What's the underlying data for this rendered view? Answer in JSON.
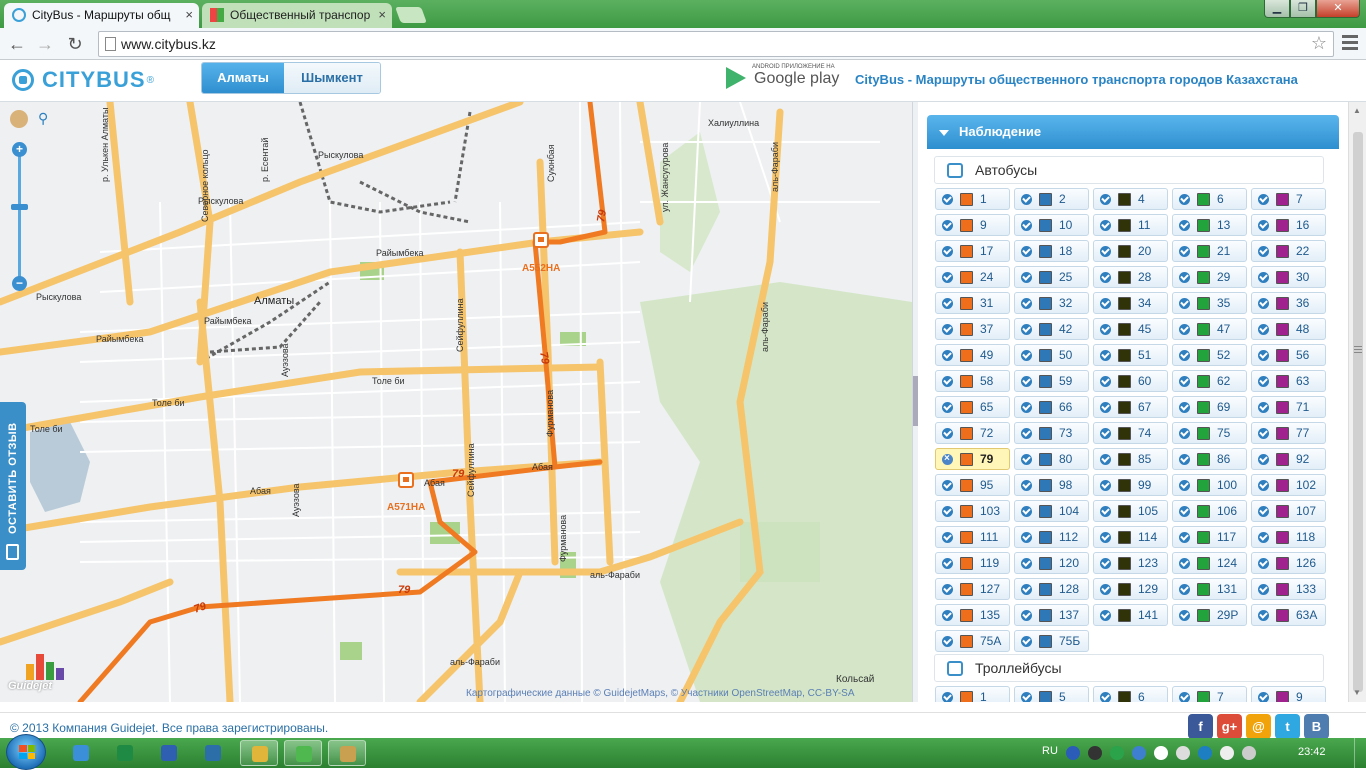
{
  "browser": {
    "tabs": [
      {
        "label": "CityBus - Маршруты общ",
        "active": true
      },
      {
        "label": "Общественный транспор",
        "active": false
      }
    ],
    "url": "www.citybus.kz"
  },
  "site": {
    "logo_text": "CITYBUS",
    "logo_reg": "®",
    "cities": [
      {
        "label": "Алматы",
        "active": true
      },
      {
        "label": "Шымкент",
        "active": false
      }
    ],
    "gplay_small": "ANDROID ПРИЛОЖЕНИЕ НА",
    "gplay_big": "Google play",
    "title": "CityBus - Маршруты общественного транспорта городов Казахстана"
  },
  "map": {
    "city_label": "Алматы",
    "district_label": "Кольсай",
    "attribution": "Картографические данные © GuidejetMaps, © Участники OpenStreetMap, CC-BY-SA",
    "guidejet_logo": "Guidejet",
    "feedback_label": "ОСТАВИТЬ ОТЗЫВ",
    "zoom_in": "+",
    "zoom_out": "−",
    "road_labels": [
      {
        "text": "Рыскулова"
      },
      {
        "text": "Рыскулова"
      },
      {
        "text": "Рыскулова"
      },
      {
        "text": "Райымбека"
      },
      {
        "text": "Райымбека"
      },
      {
        "text": "Райымбека"
      },
      {
        "text": "Толе би"
      },
      {
        "text": "Толе би"
      },
      {
        "text": "Толе би"
      },
      {
        "text": "Абая"
      },
      {
        "text": "Абая"
      },
      {
        "text": "Абая"
      },
      {
        "text": "аль-Фараби"
      },
      {
        "text": "аль-Фараби"
      },
      {
        "text": "Халиуллина"
      },
      {
        "text": "Суюнбая"
      },
      {
        "text": "Сейфуллина"
      },
      {
        "text": "Сейфуллина"
      },
      {
        "text": "Фурманова"
      },
      {
        "text": "Фурманова"
      },
      {
        "text": "Ауэзова"
      },
      {
        "text": "Ауэзова"
      },
      {
        "text": "Северное кольцо"
      },
      {
        "text": "р. Есентай"
      },
      {
        "text": "ул. Жансугурова"
      },
      {
        "text": "аль-Фараби"
      },
      {
        "text": "аль-Фараби"
      },
      {
        "text": "р. Улькен Алматы"
      }
    ],
    "route_labels": [
      "79",
      "79",
      "79",
      "79",
      "79"
    ],
    "buses": [
      {
        "label": "А552НА"
      },
      {
        "label": "А571НА"
      }
    ]
  },
  "panel": {
    "header": "Наблюдение",
    "colors": {
      "c1": "#ef6e1b",
      "c2": "#2f78b7",
      "c3": "#2f3307",
      "c4": "#23a33b",
      "c5": "#a0228f"
    },
    "groups": [
      {
        "title": "Автобусы",
        "routes": [
          {
            "n": "1",
            "c": "#ef6e1b"
          },
          {
            "n": "2",
            "c": "#2f78b7"
          },
          {
            "n": "4",
            "c": "#2f3307"
          },
          {
            "n": "6",
            "c": "#23a33b"
          },
          {
            "n": "7",
            "c": "#a0228f"
          },
          {
            "n": "9",
            "c": "#ef6e1b"
          },
          {
            "n": "10",
            "c": "#2f78b7"
          },
          {
            "n": "11",
            "c": "#2f3307"
          },
          {
            "n": "13",
            "c": "#23a33b"
          },
          {
            "n": "16",
            "c": "#a0228f"
          },
          {
            "n": "17",
            "c": "#ef6e1b"
          },
          {
            "n": "18",
            "c": "#2f78b7"
          },
          {
            "n": "20",
            "c": "#2f3307"
          },
          {
            "n": "21",
            "c": "#23a33b"
          },
          {
            "n": "22",
            "c": "#a0228f"
          },
          {
            "n": "24",
            "c": "#ef6e1b"
          },
          {
            "n": "25",
            "c": "#2f78b7"
          },
          {
            "n": "28",
            "c": "#2f3307"
          },
          {
            "n": "29",
            "c": "#23a33b"
          },
          {
            "n": "30",
            "c": "#a0228f"
          },
          {
            "n": "31",
            "c": "#ef6e1b"
          },
          {
            "n": "32",
            "c": "#2f78b7"
          },
          {
            "n": "34",
            "c": "#2f3307"
          },
          {
            "n": "35",
            "c": "#23a33b"
          },
          {
            "n": "36",
            "c": "#a0228f"
          },
          {
            "n": "37",
            "c": "#ef6e1b"
          },
          {
            "n": "42",
            "c": "#2f78b7"
          },
          {
            "n": "45",
            "c": "#2f3307"
          },
          {
            "n": "47",
            "c": "#23a33b"
          },
          {
            "n": "48",
            "c": "#a0228f"
          },
          {
            "n": "49",
            "c": "#ef6e1b"
          },
          {
            "n": "50",
            "c": "#2f78b7"
          },
          {
            "n": "51",
            "c": "#2f3307"
          },
          {
            "n": "52",
            "c": "#23a33b"
          },
          {
            "n": "56",
            "c": "#a0228f"
          },
          {
            "n": "58",
            "c": "#ef6e1b"
          },
          {
            "n": "59",
            "c": "#2f78b7"
          },
          {
            "n": "60",
            "c": "#2f3307"
          },
          {
            "n": "62",
            "c": "#23a33b"
          },
          {
            "n": "63",
            "c": "#a0228f"
          },
          {
            "n": "65",
            "c": "#ef6e1b"
          },
          {
            "n": "66",
            "c": "#2f78b7"
          },
          {
            "n": "67",
            "c": "#2f3307"
          },
          {
            "n": "69",
            "c": "#23a33b"
          },
          {
            "n": "71",
            "c": "#a0228f"
          },
          {
            "n": "72",
            "c": "#ef6e1b"
          },
          {
            "n": "73",
            "c": "#2f78b7"
          },
          {
            "n": "74",
            "c": "#2f3307"
          },
          {
            "n": "75",
            "c": "#23a33b"
          },
          {
            "n": "77",
            "c": "#a0228f"
          },
          {
            "n": "79",
            "c": "#ef6e1b",
            "selected": true
          },
          {
            "n": "80",
            "c": "#2f78b7"
          },
          {
            "n": "85",
            "c": "#2f3307"
          },
          {
            "n": "86",
            "c": "#23a33b"
          },
          {
            "n": "92",
            "c": "#a0228f"
          },
          {
            "n": "95",
            "c": "#ef6e1b"
          },
          {
            "n": "98",
            "c": "#2f78b7"
          },
          {
            "n": "99",
            "c": "#2f3307"
          },
          {
            "n": "100",
            "c": "#23a33b"
          },
          {
            "n": "102",
            "c": "#a0228f"
          },
          {
            "n": "103",
            "c": "#ef6e1b"
          },
          {
            "n": "104",
            "c": "#2f78b7"
          },
          {
            "n": "105",
            "c": "#2f3307"
          },
          {
            "n": "106",
            "c": "#23a33b"
          },
          {
            "n": "107",
            "c": "#a0228f"
          },
          {
            "n": "111",
            "c": "#ef6e1b"
          },
          {
            "n": "112",
            "c": "#2f78b7"
          },
          {
            "n": "114",
            "c": "#2f3307"
          },
          {
            "n": "117",
            "c": "#23a33b"
          },
          {
            "n": "118",
            "c": "#a0228f"
          },
          {
            "n": "119",
            "c": "#ef6e1b"
          },
          {
            "n": "120",
            "c": "#2f78b7"
          },
          {
            "n": "123",
            "c": "#2f3307"
          },
          {
            "n": "124",
            "c": "#23a33b"
          },
          {
            "n": "126",
            "c": "#a0228f"
          },
          {
            "n": "127",
            "c": "#ef6e1b"
          },
          {
            "n": "128",
            "c": "#2f78b7"
          },
          {
            "n": "129",
            "c": "#2f3307"
          },
          {
            "n": "131",
            "c": "#23a33b"
          },
          {
            "n": "133",
            "c": "#a0228f"
          },
          {
            "n": "135",
            "c": "#ef6e1b"
          },
          {
            "n": "137",
            "c": "#2f78b7"
          },
          {
            "n": "141",
            "c": "#2f3307"
          },
          {
            "n": "29Р",
            "c": "#23a33b"
          },
          {
            "n": "63А",
            "c": "#a0228f"
          },
          {
            "n": "75А",
            "c": "#ef6e1b"
          },
          {
            "n": "75Б",
            "c": "#2f78b7"
          }
        ]
      },
      {
        "title": "Троллейбусы",
        "routes": [
          {
            "n": "1",
            "c": "#ef6e1b"
          },
          {
            "n": "5",
            "c": "#2f78b7"
          },
          {
            "n": "6",
            "c": "#2f3307"
          },
          {
            "n": "7",
            "c": "#23a33b"
          },
          {
            "n": "9",
            "c": "#a0228f"
          }
        ]
      }
    ]
  },
  "footer": {
    "copyright": "© 2013 Компания Guidejet. Все права зарегистрированы.",
    "social": [
      {
        "label": "f",
        "color": "#3b5998",
        "icon": "facebook-icon"
      },
      {
        "label": "g+",
        "color": "#dd4b39",
        "icon": "google-plus-icon"
      },
      {
        "label": "@",
        "color": "#f0a30a",
        "icon": "email-icon"
      },
      {
        "label": "t",
        "color": "#2fa7e0",
        "icon": "twitter-icon"
      },
      {
        "label": "B",
        "color": "#4f7db0",
        "icon": "vkontakte-icon"
      }
    ]
  },
  "taskbar": {
    "lang": "RU",
    "time": "23:42",
    "apps": [
      {
        "icon": "calculator-icon",
        "open": false
      },
      {
        "icon": "excel-icon",
        "open": false
      },
      {
        "icon": "word-icon",
        "open": false
      },
      {
        "icon": "media-icon",
        "open": false
      },
      {
        "icon": "chrome-icon",
        "open": true
      },
      {
        "icon": "app-icon",
        "open": true
      },
      {
        "icon": "paint-icon",
        "open": true
      }
    ]
  }
}
